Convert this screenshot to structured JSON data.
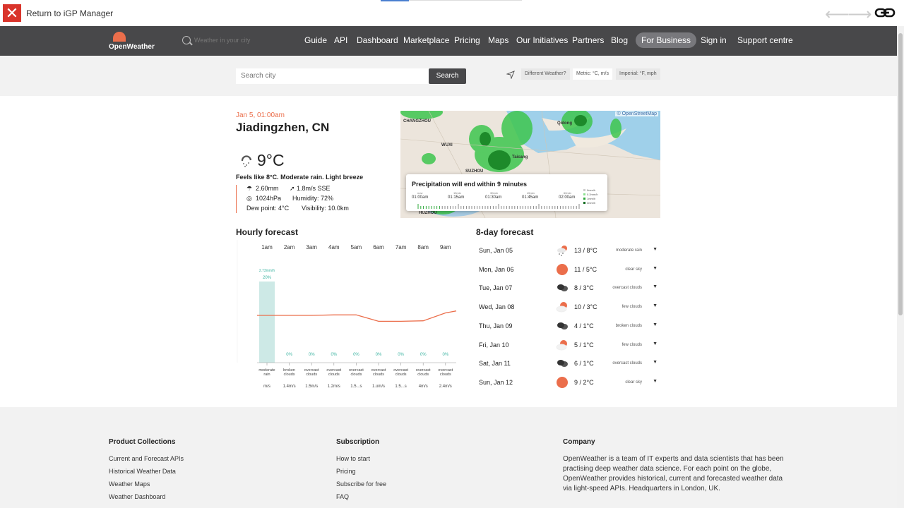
{
  "ext": {
    "close_glyph": "✕",
    "return_label": "Return to iGP Manager",
    "link_icon": "link-icon"
  },
  "brand": {
    "name": "OpenWeather",
    "accent": "#eb6e4b",
    "header_bg": "#48484a"
  },
  "header": {
    "search_placeholder": "Weather in your city",
    "nav": [
      "Guide",
      "API",
      "Dashboard",
      "Marketplace",
      "Pricing",
      "Maps",
      "Our Initiatives",
      "Partners",
      "Blog",
      "For Business",
      "Sign in",
      "Support centre"
    ]
  },
  "search": {
    "placeholder": "Search city",
    "button": "Search",
    "different_weather": "Different Weather?",
    "metric": "Metric: °C, m/s",
    "imperial": "Imperial: °F, mph"
  },
  "current": {
    "datetime": "Jan 5, 01:00am",
    "city": "Jiadingzhen, CN",
    "temp": "9°C",
    "summary": "Feels like 8°C. Moderate rain. Light breeze",
    "precip": "2.60mm",
    "wind": "1.8m/s SSE",
    "pressure": "1024hPa",
    "humidity": "Humidity: 72%",
    "dew": "Dew point: 4°C",
    "visibility": "Visibility: 10.0km"
  },
  "map": {
    "attribution": "© OpenStreetMap",
    "labels": [
      "CHANGZHOU",
      "Qidong",
      "WUXI",
      "Taicang",
      "SUZHOU",
      "HUZHOU"
    ],
    "popup": {
      "title": "Precipitation will end within 9 minutes",
      "ticks": [
        "now",
        "15min",
        "30min",
        "45min",
        "60min"
      ],
      "times": [
        "01:00am",
        "01:15am",
        "01:30am",
        "01:45am",
        "02:00am"
      ],
      "legend": [
        "0mm/h",
        "0.2mm/h",
        "1mm/h",
        "3mm/h"
      ]
    }
  },
  "hourly": {
    "title": "Hourly forecast",
    "hours": [
      "1am",
      "2am",
      "3am",
      "4am",
      "5am",
      "6am",
      "7am",
      "8am",
      "9am"
    ],
    "rain_label": "2.73mm/h",
    "pop": [
      "20%",
      "0%",
      "0%",
      "0%",
      "0%",
      "0%",
      "0%",
      "0%",
      "0%"
    ],
    "conditions": [
      [
        "moderate",
        "rain"
      ],
      [
        "broken",
        "clouds"
      ],
      [
        "overcast",
        "clouds"
      ],
      [
        "overcast",
        "clouds"
      ],
      [
        "overcast",
        "clouds"
      ],
      [
        "overcast",
        "clouds"
      ],
      [
        "overcast",
        "clouds"
      ],
      [
        "overcast",
        "clouds"
      ],
      [
        "overcast",
        "clouds"
      ]
    ],
    "wind": [
      "m/s",
      "1.4m/s",
      "1.5m/s",
      "1.2m/s",
      "1.5...s",
      "1.ʊm/s",
      "1.5...s",
      "4m/s",
      "2.4m/s"
    ]
  },
  "chart_data": {
    "type": "line",
    "categories": [
      "1am",
      "2am",
      "3am",
      "4am",
      "5am",
      "6am",
      "7am",
      "8am",
      "9am"
    ],
    "series": [],
    "bars": {
      "values": [
        2.73,
        0,
        0,
        0,
        0,
        0,
        0,
        0,
        0
      ]
    },
    "temp_curve": [
      0.0,
      0.0,
      0.0,
      0.05,
      0.05,
      -0.6,
      -0.6,
      -0.55,
      0.25
    ]
  },
  "daily": {
    "title": "8-day forecast",
    "rows": [
      {
        "day": "Sun, Jan 05",
        "temp": "13 / 8°C",
        "cond": "moderate rain",
        "icon": "rain-icon"
      },
      {
        "day": "Mon, Jan 06",
        "temp": "11 / 5°C",
        "cond": "clear sky",
        "icon": "sun-icon"
      },
      {
        "day": "Tue, Jan 07",
        "temp": "8 / 3°C",
        "cond": "overcast clouds",
        "icon": "clouds-icon"
      },
      {
        "day": "Wed, Jan 08",
        "temp": "10 / 3°C",
        "cond": "few clouds",
        "icon": "sun-cloud-icon"
      },
      {
        "day": "Thu, Jan 09",
        "temp": "4 / 1°C",
        "cond": "broken clouds",
        "icon": "clouds-icon"
      },
      {
        "day": "Fri, Jan 10",
        "temp": "5 / 1°C",
        "cond": "few clouds",
        "icon": "sun-cloud-icon"
      },
      {
        "day": "Sat, Jan 11",
        "temp": "6 / 1°C",
        "cond": "overcast clouds",
        "icon": "clouds-icon"
      },
      {
        "day": "Sun, Jan 12",
        "temp": "9 / 2°C",
        "cond": "clear sky",
        "icon": "sun-icon"
      }
    ]
  },
  "footer": {
    "product": {
      "title": "Product Collections",
      "links": [
        "Current and Forecast APIs",
        "Historical Weather Data",
        "Weather Maps",
        "Weather Dashboard"
      ]
    },
    "subscription": {
      "title": "Subscription",
      "links": [
        "How to start",
        "Pricing",
        "Subscribe for free",
        "FAQ"
      ]
    },
    "company": {
      "title": "Company",
      "text": "OpenWeather is a team of IT experts and data scientists that has been practising deep weather data science. For each point on the globe, OpenWeather provides historical, current and forecasted weather data via light-speed APIs. Headquarters in London, UK."
    }
  }
}
